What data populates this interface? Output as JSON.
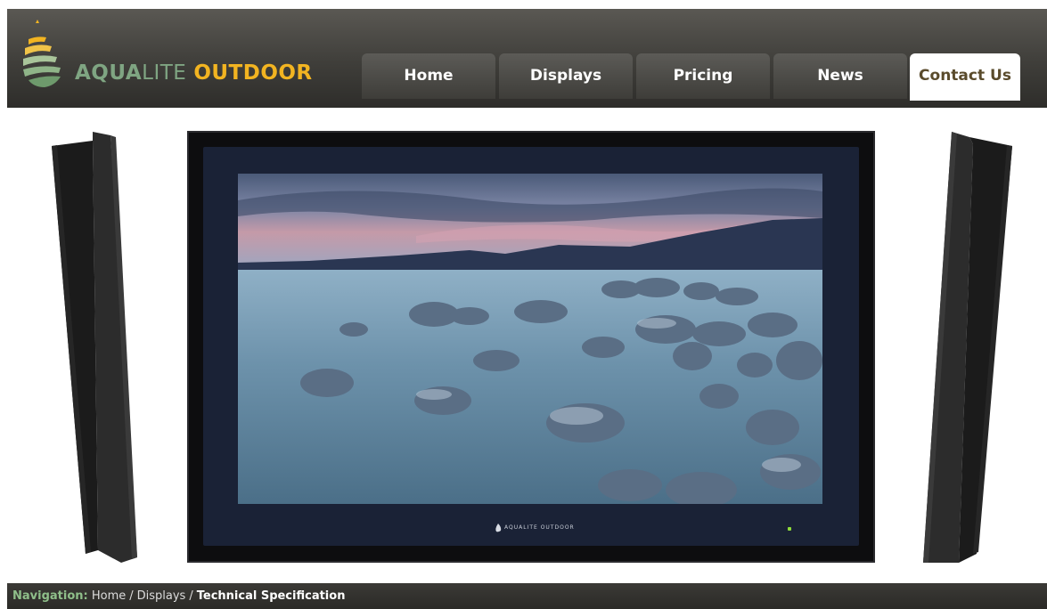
{
  "brand": {
    "part1": "AQUA",
    "part2": "LITE",
    "part3": "OUTDOOR"
  },
  "nav": {
    "tabs": [
      {
        "label": "Home",
        "active": false
      },
      {
        "label": "Displays",
        "active": false
      },
      {
        "label": "Pricing",
        "active": false
      },
      {
        "label": "News",
        "active": false
      },
      {
        "label": "Contact Us",
        "active": true
      }
    ]
  },
  "display": {
    "bezel_brand": "AQUALITE OUTDOOR"
  },
  "breadcrumb": {
    "label": "Navigation:",
    "items": [
      "Home",
      "Displays",
      "Technical Specification"
    ],
    "separator": "/"
  },
  "colors": {
    "header_bg": "#3f3e3a",
    "brand_green": "#7fa582",
    "brand_gold": "#f2b421",
    "active_tab_text": "#5a4b2c",
    "led": "#8fdc3a"
  }
}
